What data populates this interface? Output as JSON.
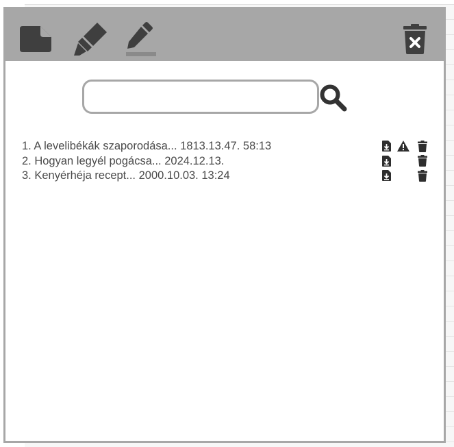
{
  "toolbar": {
    "icons": [
      "note-icon",
      "highlighter-icon",
      "pen-icon",
      "trash-x-icon"
    ],
    "colors": {
      "bar": "#a7a7a7",
      "icon": "#3f3f3f"
    }
  },
  "search": {
    "value": "",
    "placeholder": "",
    "icon": "magnifier-icon"
  },
  "notes": {
    "items": [
      {
        "label": "1. A levelibékák szaporodása... 1813.13.47. 58:13",
        "warning": true
      },
      {
        "label": "2. Hogyan legyél pogácsa... 2024.12.13.",
        "warning": false
      },
      {
        "label": "3. Kenyérhéja recept... 2000.10.03. 13:24",
        "warning": false
      }
    ],
    "row_icons": [
      "download-file-icon",
      "warning-icon",
      "trash-icon"
    ]
  }
}
